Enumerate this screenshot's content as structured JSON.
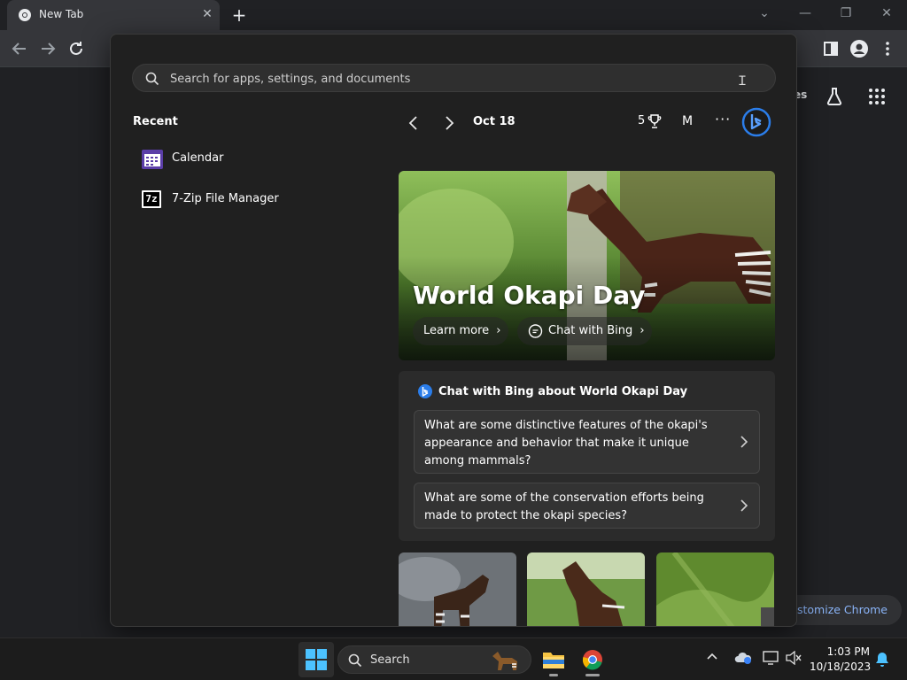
{
  "browser": {
    "tab_title": "New Tab",
    "tab_close": "✕",
    "new_tab": "+",
    "window_controls": [
      "⌄",
      "—",
      "❐",
      "✕"
    ],
    "ntp": {
      "header_fragment": "es",
      "customize_label": "stomize Chrome"
    }
  },
  "start_menu": {
    "search_placeholder": "Search for apps, settings, and documents",
    "recent": {
      "title": "Recent",
      "items": [
        {
          "label": "Calendar",
          "icon": "calendar-icon"
        },
        {
          "label": "7-Zip File Manager",
          "icon": "7zip-icon",
          "icon_text": "7z"
        }
      ]
    },
    "feed": {
      "date": "Oct 18",
      "points": "5",
      "account_initial": "M",
      "more": "···",
      "hero": {
        "title": "World Okapi Day",
        "learn_more": "Learn more",
        "chat_with_bing": "Chat with Bing"
      },
      "chat_card": {
        "title": "Chat with Bing about World Okapi Day",
        "questions": [
          "What are some distinctive features of the okapi's appearance and behavior that make it unique among mammals?",
          "What are some of the conservation efforts being made to protect the okapi species?"
        ]
      }
    }
  },
  "taskbar": {
    "search_label": "Search",
    "time": "1:03 PM",
    "date": "10/18/2023"
  },
  "colors": {
    "start_bg": "#202020",
    "card_bg": "#2b2b2b",
    "accent_blue": "#8ab4f8",
    "bing_blue": "#2b7de9"
  }
}
